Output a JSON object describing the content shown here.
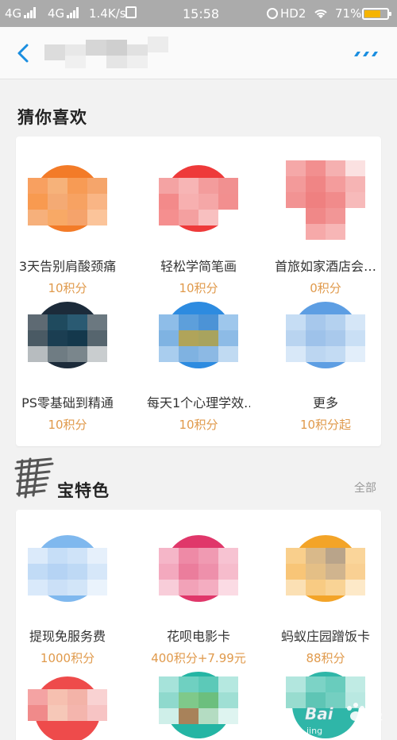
{
  "status_bar": {
    "network1": "4G",
    "network2": "4G",
    "speed": "1.4K/s",
    "time": "15:58",
    "hd": "HD2",
    "battery_text": "71%",
    "battery_level": 0.71
  },
  "navbar": {
    "back_icon": "chevron-left-icon",
    "more_icon": "more-dots-icon",
    "accent_color": "#1a8ee0"
  },
  "guess": {
    "title": "猜你喜欢",
    "items": [
      {
        "label": "3天告别肩酸颈痛",
        "price": "10积分"
      },
      {
        "label": "轻松学简笔画",
        "price": "10积分"
      },
      {
        "label": "首旅如家酒店会…",
        "price": "0积分"
      },
      {
        "label": "PS零基础到精通",
        "price": "10积分"
      },
      {
        "label": "每天1个心理学效..",
        "price": "10积分"
      },
      {
        "label": "更多",
        "price": "10积分起"
      }
    ]
  },
  "features": {
    "title": "宝特色",
    "see_all": "全部",
    "items": [
      {
        "label": "提现免服务费",
        "price": "1000积分"
      },
      {
        "label": "花呗电影卡",
        "price": "400积分+7.99元"
      },
      {
        "label": "蚂蚁庄园蹭饭卡",
        "price": "88积分"
      }
    ]
  },
  "colors": {
    "price": "#e09a4c",
    "status_bar": "#ababab"
  },
  "watermark": {
    "text": "Bai",
    "sub": "jing"
  }
}
